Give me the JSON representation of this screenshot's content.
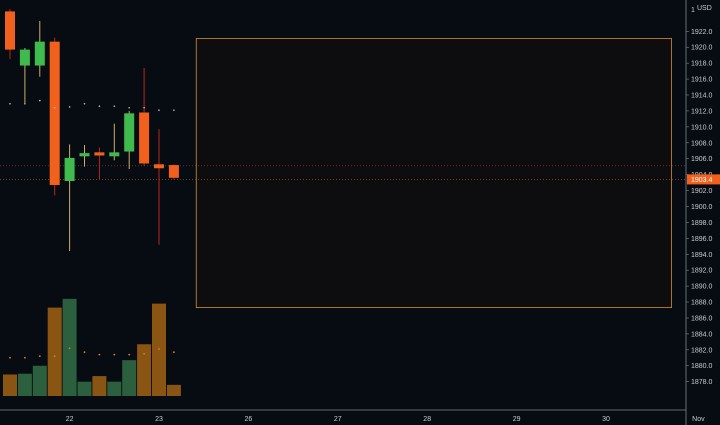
{
  "chart_data": {
    "type": "candlestick",
    "currency_label": "USD",
    "price_axis": {
      "ticks": [
        1922.0,
        1920.0,
        1918.0,
        1916.0,
        1914.0,
        1912.0,
        1910.0,
        1908.0,
        1906.0,
        1904.0,
        1902.0,
        1900.0,
        1898.0,
        1896.0,
        1894.0,
        1892.0,
        1890.0,
        1888.0,
        1886.0,
        1884.0,
        1882.0,
        1880.0,
        1878.0
      ],
      "top_tick": "1",
      "ylim": [
        1876.2,
        1924.8
      ]
    },
    "current_price_label": "1903.4",
    "current_price": 1903.4,
    "reference_line_price": 1905.1,
    "time_axis": {
      "labels": [
        {
          "label": "22",
          "index": 4
        },
        {
          "label": "23",
          "index": 10
        },
        {
          "label": "26",
          "index": 16
        },
        {
          "label": "27",
          "index": 22
        },
        {
          "label": "28",
          "index": 28
        },
        {
          "label": "29",
          "index": 34
        },
        {
          "label": "30",
          "index": 40
        },
        {
          "label": "Nov",
          "index": 46.2
        }
      ]
    },
    "candles": [
      {
        "o": 1924.5,
        "h": 1924.8,
        "l": 1918.5,
        "c": 1919.7
      },
      {
        "o": 1917.7,
        "h": 1919.9,
        "l": 1913.0,
        "c": 1919.7
      },
      {
        "o": 1917.7,
        "h": 1923.3,
        "l": 1916.3,
        "c": 1920.7
      },
      {
        "o": 1920.7,
        "h": 1921.2,
        "l": 1901.4,
        "c": 1902.7
      },
      {
        "o": 1903.2,
        "h": 1907.8,
        "l": 1894.4,
        "c": 1906.1
      },
      {
        "o": 1906.3,
        "h": 1907.7,
        "l": 1905.0,
        "c": 1906.7
      },
      {
        "o": 1906.8,
        "h": 1907.4,
        "l": 1903.4,
        "c": 1906.4
      },
      {
        "o": 1906.3,
        "h": 1910.4,
        "l": 1905.8,
        "c": 1906.8
      },
      {
        "o": 1906.9,
        "h": 1912.0,
        "l": 1904.7,
        "c": 1911.7
      },
      {
        "o": 1911.8,
        "h": 1917.4,
        "l": 1905.1,
        "c": 1905.4
      },
      {
        "o": 1905.3,
        "h": 1909.7,
        "l": 1895.2,
        "c": 1904.8
      },
      {
        "o": 1905.2,
        "h": 1905.3,
        "l": 1903.4,
        "c": 1903.6
      }
    ],
    "volume_avg_dots": [
      1881.0,
      1881.0,
      1881.2,
      1881.2,
      1882.2,
      1881.7,
      1881.4,
      1881.4,
      1881.4,
      1881.5,
      1882.1,
      1881.7
    ],
    "upper_dots": [
      1912.9,
      1912.9,
      1913.3,
      1912.4,
      1912.5,
      1912.9,
      1912.6,
      1912.6,
      1912.4,
      1912.4,
      1912.1,
      1912.1
    ],
    "volumes": [
      1878.9,
      1879.0,
      1880.0,
      1887.3,
      1888.4,
      1878.0,
      1878.7,
      1878.0,
      1880.7,
      1882.7,
      1887.8,
      1877.6
    ],
    "volume_base": 1876.2,
    "forecast_box": {
      "price_top": 1921.1,
      "price_bottom": 1887.3,
      "index_start": 12.5,
      "index_end": 44.4
    }
  },
  "colors": {
    "background": "#070b12",
    "up": "#3fbb4e",
    "down": "#f2601d",
    "wick_down": "#b7281d",
    "wick_up": "#ccaf63",
    "volume_up": "#2c5f3d",
    "volume_down": "#8a5412",
    "box_stroke": "#d98d2a",
    "box_fill": "#0d0d0f",
    "price_tag": "#f2601d",
    "axis_line": "#7f8591",
    "label": "#c8ccd2",
    "ref_line": "#b85a1c",
    "dot": "#c8c5b6",
    "dot_orange": "#e07d26"
  }
}
